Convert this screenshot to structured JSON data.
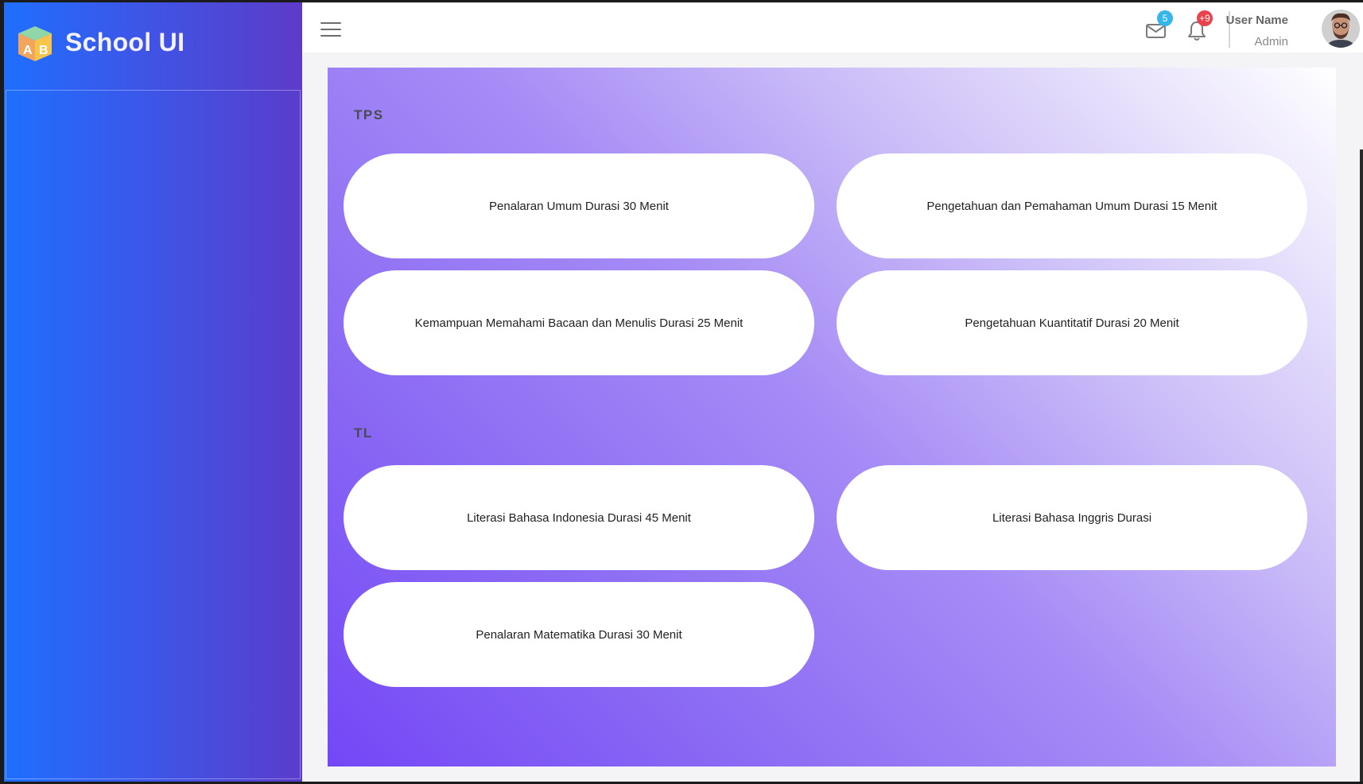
{
  "app": {
    "title": "School UI",
    "logo": {
      "letters": [
        "A",
        "B"
      ],
      "colors": [
        "#f58c4b",
        "#f7c54a",
        "#7fc6f0",
        "#f26b8a"
      ]
    }
  },
  "header": {
    "mail_badge": "5",
    "notification_badge": "+9",
    "user_name": "User Name",
    "user_role": "Admin",
    "colors": {
      "mail_badge": "#36b5e8",
      "notification_badge": "#e8434c"
    }
  },
  "sections": [
    {
      "title": "TPS",
      "items": [
        {
          "label": "Penalaran Umum Durasi 30 Menit"
        },
        {
          "label": "Pengetahuan dan Pemahaman Umum Durasi 15 Menit"
        },
        {
          "label": "Kemampuan Memahami Bacaan dan Menulis Durasi 25 Menit"
        },
        {
          "label": "Pengetahuan Kuantitatif Durasi 20 Menit"
        }
      ]
    },
    {
      "title": "TL",
      "items": [
        {
          "label": "Literasi Bahasa Indonesia Durasi 45 Menit"
        },
        {
          "label": "Literasi Bahasa Inggris Durasi"
        },
        {
          "label": "Penalaran Matematika Durasi 30 Menit"
        }
      ]
    }
  ],
  "theme": {
    "sidebar_gradient": [
      "#1f6fff",
      "#5b3ccb"
    ],
    "content_gradient": [
      "#7447f6",
      "#ffffff"
    ]
  }
}
